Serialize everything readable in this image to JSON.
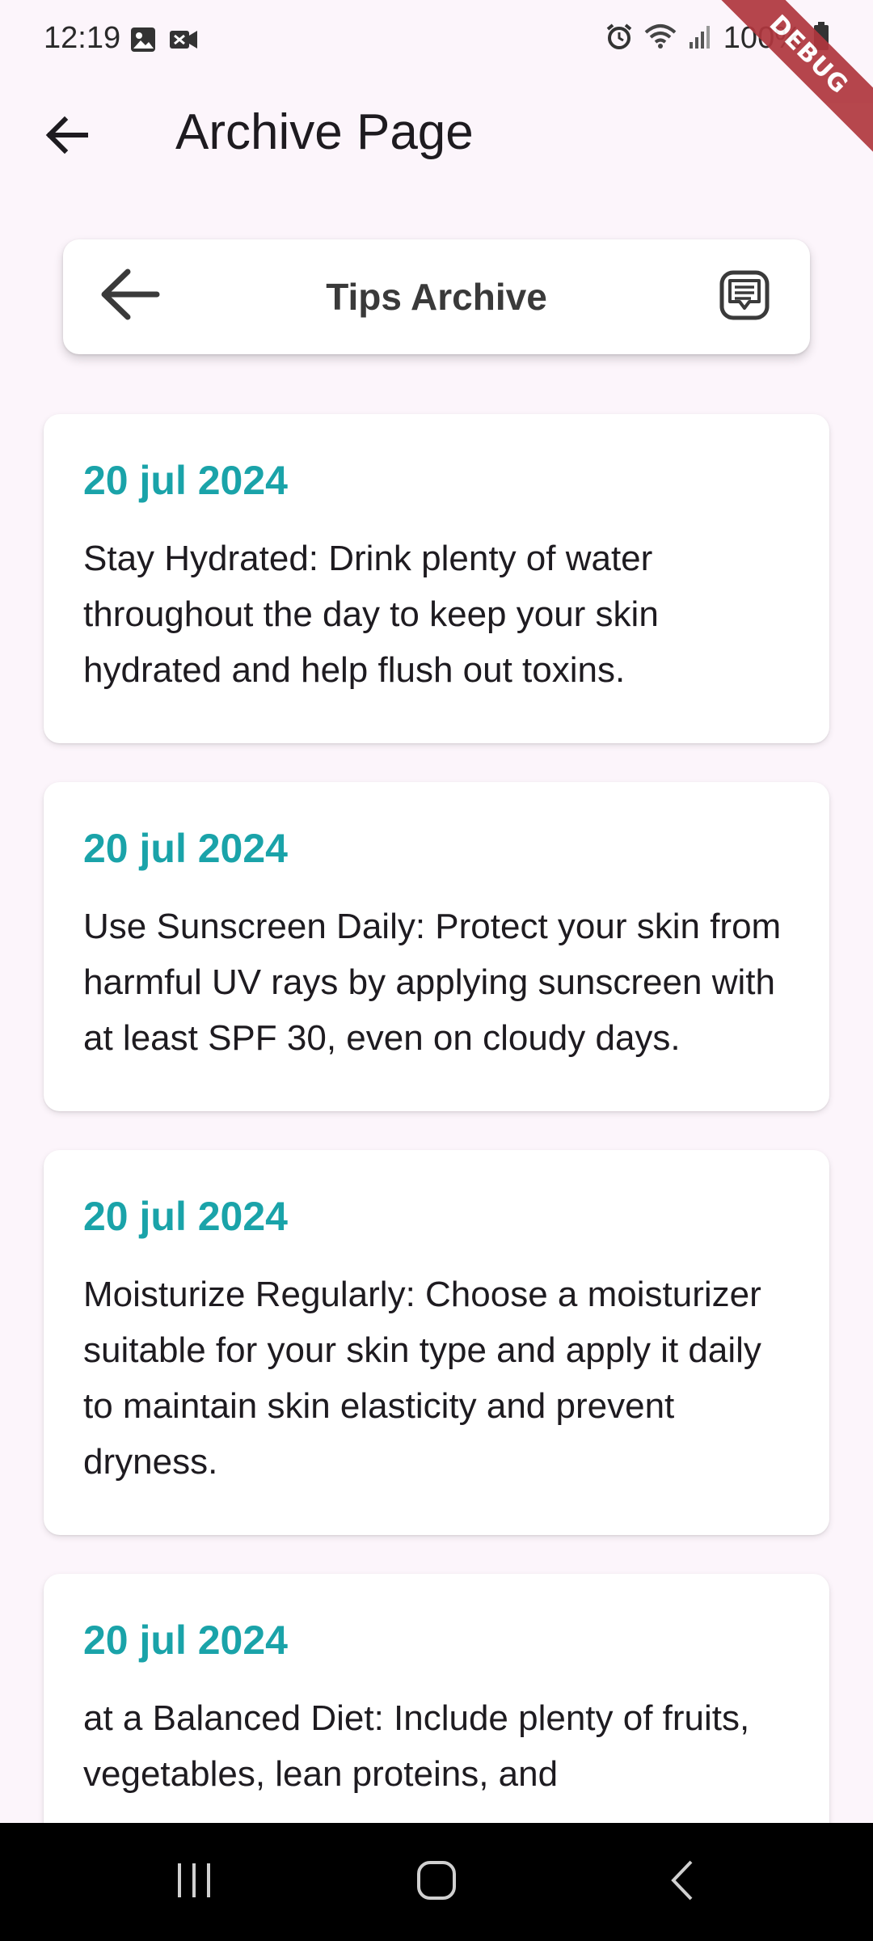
{
  "status_bar": {
    "time": "12:19",
    "battery": "100%"
  },
  "debug_banner": "DEBUG",
  "app_bar": {
    "title": "Archive Page"
  },
  "header_card": {
    "title": "Tips Archive"
  },
  "tips": [
    {
      "date": "20 jul 2024",
      "text": "Stay Hydrated: Drink plenty of water throughout the day to keep your skin hydrated and help flush out toxins."
    },
    {
      "date": "20 jul 2024",
      "text": "Use Sunscreen Daily: Protect your skin from harmful UV rays by applying sunscreen with at least SPF 30, even on cloudy days."
    },
    {
      "date": "20 jul 2024",
      "text": "Moisturize Regularly: Choose a moisturizer suitable for your skin type and apply it daily to maintain skin elasticity and prevent dryness."
    },
    {
      "date": "20 jul 2024",
      "text": "at a Balanced Diet: Include plenty of fruits, vegetables, lean proteins, and"
    }
  ],
  "colors": {
    "background": "#FCF5FB",
    "date_accent": "#1AA3A9",
    "debug_ribbon": "#B0373E"
  },
  "icons": {
    "app_back": "arrow-left-icon",
    "header_back": "arrow-left-icon",
    "header_action": "chat-bubble-icon",
    "nav_recents": "recents-icon",
    "nav_home": "home-icon",
    "nav_back": "back-chevron-icon"
  }
}
